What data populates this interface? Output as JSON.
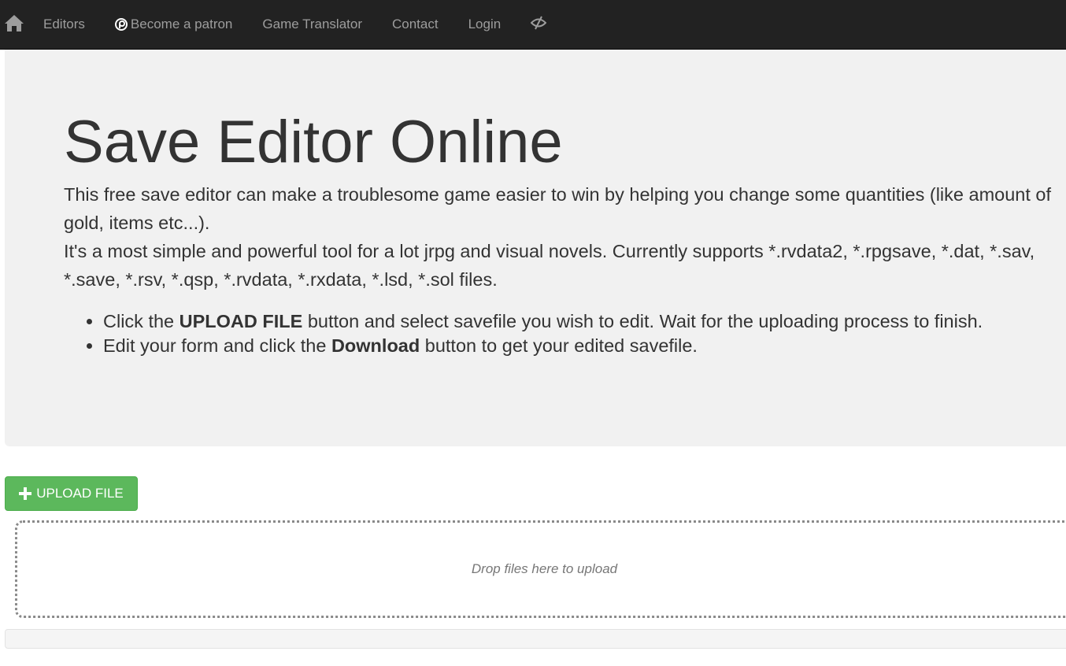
{
  "nav": {
    "home_icon": "home-icon",
    "items": [
      {
        "label": "Editors"
      },
      {
        "label": "Become a patron",
        "icon": "patreon-icon"
      },
      {
        "label": "Game Translator"
      },
      {
        "label": "Contact"
      },
      {
        "label": "Login"
      }
    ],
    "theme_icon": "eye-slash-icon"
  },
  "jumbotron": {
    "title": "Save Editor Online",
    "lead1": "This free save editor can make a troublesome game easier to win by helping you change some quantities (like amount of gold, items etc...).",
    "lead2": "It's a most simple and powerful tool for a lot jrpg and visual novels. Currently supports *.rvdata2, *.rpgsave, *.dat, *.sav, *.save, *.rsv, *.qsp, *.rvdata, *.rxdata, *.lsd, *.sol files.",
    "steps": [
      {
        "pre": "Click the ",
        "bold": "UPLOAD FILE",
        "post": " button and select savefile you wish to edit. Wait for the uploading process to finish."
      },
      {
        "pre": "Edit your form and click the ",
        "bold": "Download",
        "post": " button to get your edited savefile."
      }
    ]
  },
  "upload": {
    "label": "UPLOAD FILE",
    "icon": "plus-icon",
    "color": "#5cb85c"
  },
  "dropzone": {
    "text": "Drop files here to upload"
  }
}
